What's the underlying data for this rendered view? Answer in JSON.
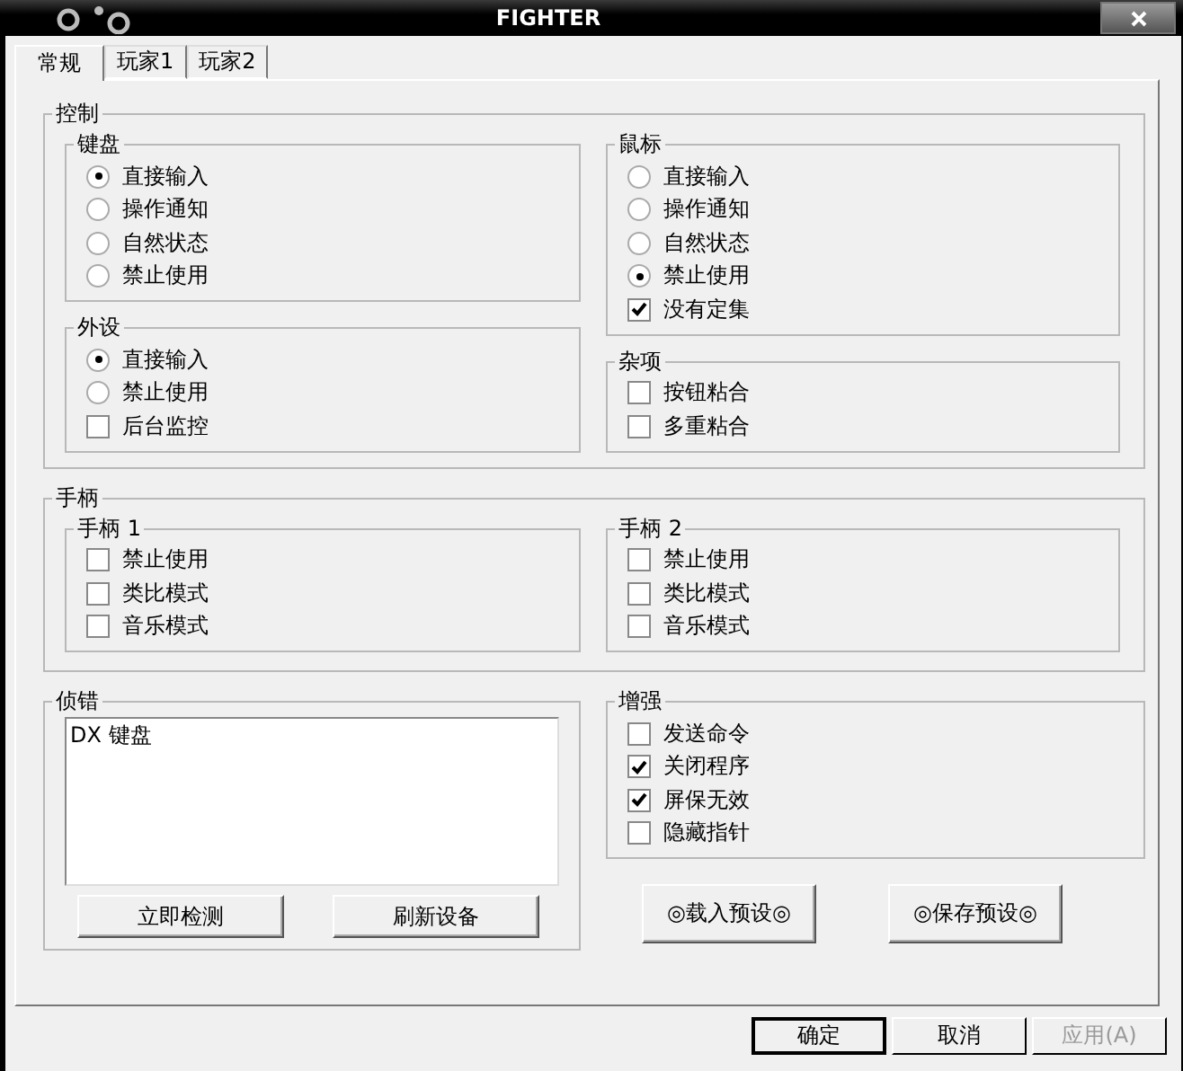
{
  "window": {
    "title": "FIGHTER"
  },
  "tabs": [
    {
      "label": "常规",
      "selected": true
    },
    {
      "label": "玩家1",
      "selected": false
    },
    {
      "label": "玩家2",
      "selected": false
    }
  ],
  "control": {
    "title": "控制",
    "keyboard": {
      "title": "键盘",
      "items": [
        {
          "kind": "radio",
          "label": "直接输入",
          "selected": true
        },
        {
          "kind": "radio",
          "label": "操作通知",
          "selected": false
        },
        {
          "kind": "radio",
          "label": "自然状态",
          "selected": false
        },
        {
          "kind": "radio",
          "label": "禁止使用",
          "selected": false
        }
      ]
    },
    "peripheral": {
      "title": "外设",
      "items": [
        {
          "kind": "radio",
          "label": "直接输入",
          "selected": true
        },
        {
          "kind": "radio",
          "label": "禁止使用",
          "selected": false
        },
        {
          "kind": "checkbox",
          "label": "后台监控",
          "checked": false
        }
      ]
    },
    "mouse": {
      "title": "鼠标",
      "items": [
        {
          "kind": "radio",
          "label": "直接输入",
          "selected": false
        },
        {
          "kind": "radio",
          "label": "操作通知",
          "selected": false
        },
        {
          "kind": "radio",
          "label": "自然状态",
          "selected": false
        },
        {
          "kind": "radio",
          "label": "禁止使用",
          "selected": true
        },
        {
          "kind": "checkbox",
          "label": "没有定集",
          "checked": true
        }
      ]
    },
    "misc": {
      "title": "杂项",
      "items": [
        {
          "kind": "checkbox",
          "label": "按钮粘合",
          "checked": false
        },
        {
          "kind": "checkbox",
          "label": "多重粘合",
          "checked": false
        }
      ]
    }
  },
  "gamepad": {
    "title": "手柄",
    "pad1": {
      "title": "手柄 1",
      "items": [
        {
          "kind": "checkbox",
          "label": "禁止使用",
          "checked": false
        },
        {
          "kind": "checkbox",
          "label": "类比模式",
          "checked": false
        },
        {
          "kind": "checkbox",
          "label": "音乐模式",
          "checked": false
        }
      ]
    },
    "pad2": {
      "title": "手柄 2",
      "items": [
        {
          "kind": "checkbox",
          "label": "禁止使用",
          "checked": false
        },
        {
          "kind": "checkbox",
          "label": "类比模式",
          "checked": false
        },
        {
          "kind": "checkbox",
          "label": "音乐模式",
          "checked": false
        }
      ]
    }
  },
  "debug": {
    "title": "侦错",
    "list": [
      "DX 键盘"
    ],
    "buttons": [
      "立即检测",
      "刷新设备"
    ]
  },
  "enhance": {
    "title": "增强",
    "items": [
      {
        "kind": "checkbox",
        "label": "发送命令",
        "checked": false
      },
      {
        "kind": "checkbox",
        "label": "关闭程序",
        "checked": true
      },
      {
        "kind": "checkbox",
        "label": "屏保无效",
        "checked": true
      },
      {
        "kind": "checkbox",
        "label": "隐藏指针",
        "checked": false
      }
    ]
  },
  "preset_buttons": [
    "◎载入预设◎",
    "◎保存预设◎"
  ],
  "footer_buttons": [
    {
      "label": "确定",
      "disabled": false,
      "default": true
    },
    {
      "label": "取消",
      "disabled": false,
      "default": false
    },
    {
      "label": "应用(A)",
      "disabled": true,
      "default": false
    }
  ]
}
